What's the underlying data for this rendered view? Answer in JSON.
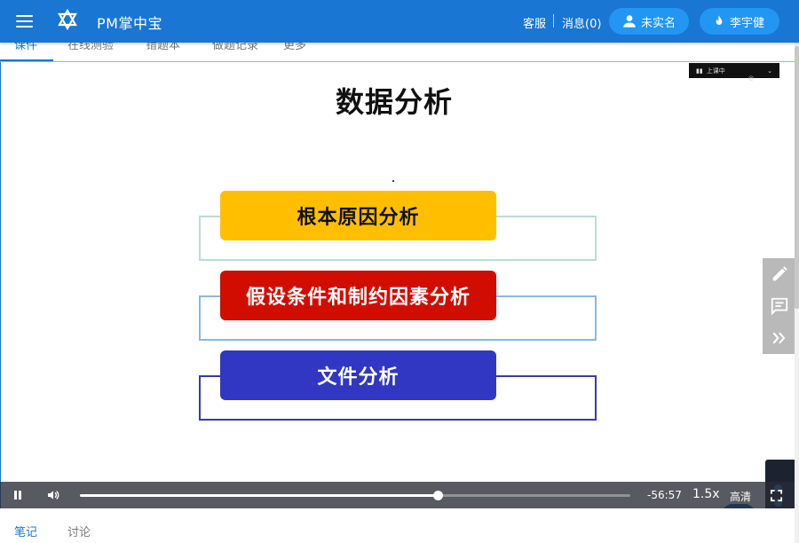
{
  "header": {
    "app_title": "PM掌中宝",
    "customer_service": "客服",
    "messages": "消息(0)",
    "unverified": "未实名",
    "user_name": "李宇健"
  },
  "tabs": [
    {
      "label": "课件",
      "active": true
    },
    {
      "label": "在线测验",
      "active": false
    },
    {
      "label": "错题本",
      "active": false
    },
    {
      "label": "做题记录",
      "active": false
    },
    {
      "label": "更多",
      "active": false
    }
  ],
  "slide": {
    "title": "数据分析",
    "items": [
      {
        "label": "根本原因分析",
        "fill": "#ffbf00",
        "text_color": "#111111",
        "frame": "#b8ddd6"
      },
      {
        "label": "假设条件和制约因素分析",
        "fill": "#d10d00",
        "text_color": "#ffffff",
        "frame": "#8ab8dd"
      },
      {
        "label": "文件分析",
        "fill": "#3137c2",
        "text_color": "#ffffff",
        "frame": "#3a3aa0"
      }
    ],
    "mini_bar_label": "上课中"
  },
  "player": {
    "progress": 0.65,
    "time_remaining": "-56:57",
    "playback_rate": "1.5x",
    "quality": "高清"
  },
  "bottom_tabs": [
    {
      "label": "笔记",
      "active": true
    },
    {
      "label": "讨论",
      "active": false
    }
  ],
  "colors": {
    "primary": "#1976d2",
    "pill": "#2196f3"
  }
}
